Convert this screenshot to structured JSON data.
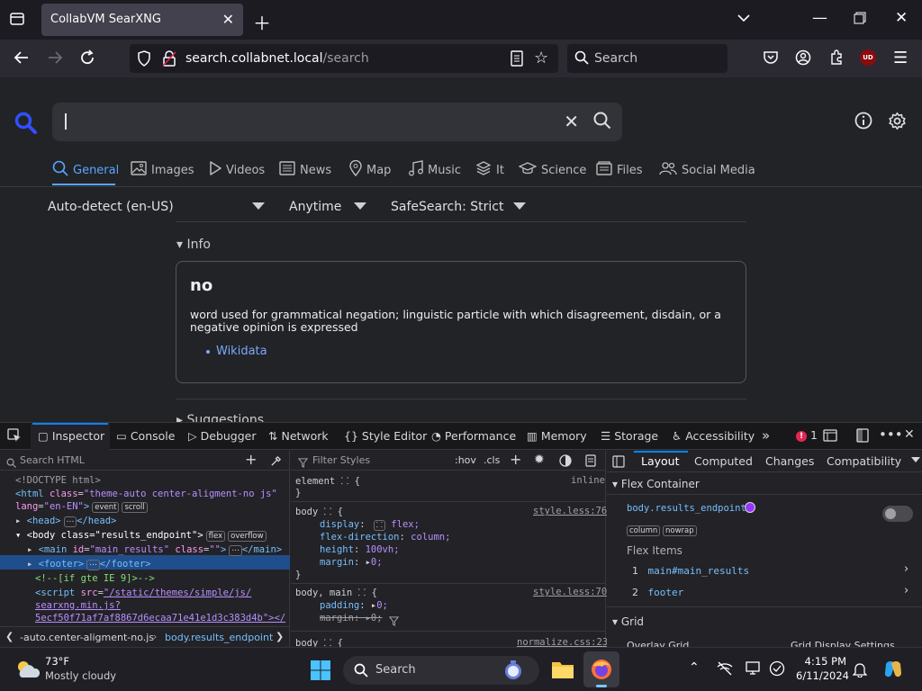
{
  "browser": {
    "tab_title": "CollabVM SearXNG",
    "url_host": "search.collabnet.local",
    "url_path": "/search",
    "search_placeholder": "Search",
    "ext_badge": "UD"
  },
  "searx": {
    "query_value": "",
    "categories": [
      {
        "label": "General",
        "icon": "search-icon"
      },
      {
        "label": "Images",
        "icon": "image-icon"
      },
      {
        "label": "Videos",
        "icon": "play-icon"
      },
      {
        "label": "News",
        "icon": "newspaper-icon"
      },
      {
        "label": "Map",
        "icon": "map-pin-icon"
      },
      {
        "label": "Music",
        "icon": "music-note-icon"
      },
      {
        "label": "It",
        "icon": "layers-icon"
      },
      {
        "label": "Science",
        "icon": "graduation-cap-icon"
      },
      {
        "label": "Files",
        "icon": "files-icon"
      },
      {
        "label": "Social Media",
        "icon": "people-icon"
      }
    ],
    "filters": {
      "language": "Auto-detect (en-US)",
      "time": "Anytime",
      "safesearch": "SafeSearch: Strict"
    },
    "info_label": "Info",
    "infobox": {
      "title": "no",
      "description": "word used for grammatical negation; linguistic particle with which disagreement, disdain, or a negative opinion is expressed",
      "link": "Wikidata"
    },
    "suggestions_label": "Suggestions"
  },
  "devtools": {
    "tabs": [
      "Inspector",
      "Console",
      "Debugger",
      "Network",
      "Style Editor",
      "Performance",
      "Memory",
      "Storage",
      "Accessibility"
    ],
    "error_count": "1",
    "html_search_placeholder": "Search HTML",
    "markup": {
      "doctype": "<!DOCTYPE html>",
      "html_open": "<html",
      "html_class_attr": "class",
      "html_class_val": "\"theme-auto center-aligment-no js\"",
      "html_lang_attr": "lang",
      "html_lang_val": "\"en-EN\"",
      "badge_event": "event",
      "badge_scroll": "scroll",
      "head": "<head>",
      "head_close": "</head>",
      "body_open": "<body",
      "body_class_val": "\"results_endpoint\"",
      "badge_flex": "flex",
      "badge_overflow": "overflow",
      "main_open": "<main",
      "main_id_attr": "id",
      "main_id_val": "\"main_results\"",
      "main_class_val": "\"\"",
      "main_close": "</main>",
      "footer_open": "<footer>",
      "footer_close": "</footer>",
      "comment": "<!--[if gte IE 9]>-->",
      "script_open": "<script",
      "script_src_attr": "src",
      "script_src_1": "\"/static/themes/simple/js/",
      "script_src_2": "searxng.min.js?",
      "script_src_3": "5ecf50f71af7af8867d6ecaa71e41e1d3c383d4b\"></"
    },
    "breadcrumbs": [
      "-auto.center-aligment-no.js",
      "body.results_endpoint"
    ],
    "css_filter_placeholder": "Filter Styles",
    "css_buttons": [
      ":hov",
      ".cls"
    ],
    "css_rules": {
      "element_sel": "element",
      "element_src": "inline",
      "body_sel": "body",
      "body_src": "style.less:76",
      "display": "display",
      "display_val": "flex;",
      "flex_direction": "flex-direction",
      "flex_direction_val": "column;",
      "height": "height",
      "height_val": "100vh;",
      "margin": "margin",
      "margin_val": "0;",
      "body_main_sel": "body, main",
      "body_main_src": "style.less:70",
      "padding": "padding",
      "padding_val": "0;",
      "margin_struck": "margin",
      "margin_struck_val": "0;",
      "normalize_sel": "body",
      "normalize_src": "normalize.css:23"
    },
    "layout_tabs": [
      "Layout",
      "Computed",
      "Changes",
      "Compatibility"
    ],
    "flex_container_label": "Flex Container",
    "flex_element": "body.results_endpoint",
    "flex_badges": [
      "column",
      "nowrap"
    ],
    "flex_items_label": "Flex Items",
    "flex_items": [
      {
        "num": "1",
        "name": "main#main_results"
      },
      {
        "num": "2",
        "name": "footer"
      }
    ],
    "grid_label": "Grid",
    "grid_overlay": "Overlay Grid",
    "grid_display": "Grid Display Settings"
  },
  "taskbar": {
    "temp": "73°F",
    "weather": "Mostly cloudy",
    "search_label": "Search",
    "time": "4:15 PM",
    "date": "6/11/2024"
  },
  "colors": {
    "accent": "#58a6ff",
    "devtools_accent": "#0a84ff",
    "selection": "#204e8a"
  }
}
